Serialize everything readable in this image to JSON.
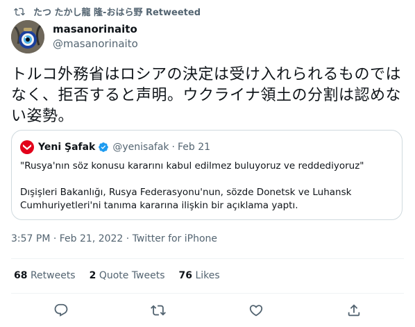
{
  "retweet_banner": {
    "text": "たつ たかし龍 隆-おはら野 Retweeted"
  },
  "author": {
    "name": "masanorinaito",
    "handle": "@masanorinaito"
  },
  "tweet": {
    "text": "トルコ外務省はロシアの決定は受け入れられるものではなく、拒否すると声明。ウクライナ領土の分割は認めない姿勢。"
  },
  "quote": {
    "name": "Yeni Şafak",
    "handle": "@yenisafak",
    "separator": "·",
    "date": "Feb 21",
    "line1": "\"Rusya'nın söz konusu kararını kabul edilmez buluyoruz ve reddediyoruz\"",
    "line2": "Dışişleri Bakanlığı, Rusya Federasyonu'nun, sözde Donetsk ve Luhansk Cumhuriyetleri'ni tanıma kararına ilişkin bir açıklama yaptı."
  },
  "timestamp": "3:57 PM · Feb 21, 2022 · Twitter for iPhone",
  "stats": {
    "retweets_count": "68",
    "retweets_label": "Retweets",
    "quotes_count": "2",
    "quotes_label": "Quote Tweets",
    "likes_count": "76",
    "likes_label": "Likes"
  },
  "icons": {
    "retweet_banner": "retweet-icon",
    "verified": "verified-badge-icon",
    "reply": "reply-icon",
    "retweet": "retweet-icon",
    "like": "heart-icon",
    "share": "share-icon"
  },
  "colors": {
    "text": "#0f1419",
    "secondary": "#536471",
    "verified": "#1d9bf0",
    "brand_red": "#e2001a"
  }
}
